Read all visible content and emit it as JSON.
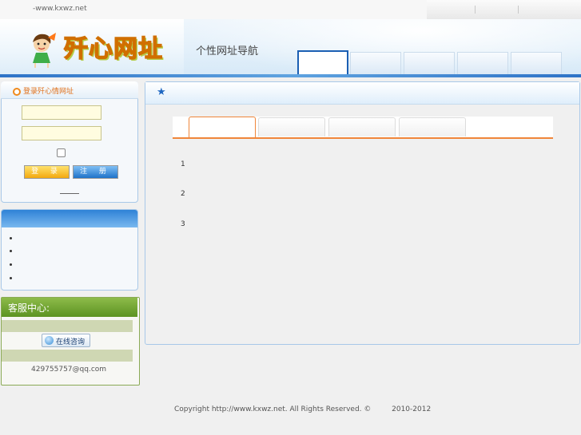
{
  "topbar": {
    "url_text": "-www.kxwz.net"
  },
  "header": {
    "logo_text": "歼心网址",
    "slogan": "个性网址导航",
    "brand_colors": {
      "primary": "#1b5fb3",
      "accent": "#f0863a",
      "logo_yellow": "#ffd21f"
    },
    "nav_tabs": [
      {
        "label": ""
      },
      {
        "label": ""
      },
      {
        "label": ""
      },
      {
        "label": ""
      },
      {
        "label": ""
      }
    ]
  },
  "login": {
    "title": "登录歼心情网址",
    "username_value": "",
    "password_value": "",
    "remember_checked": false,
    "signin_label": "登 录",
    "register_label": "注 册",
    "divider_text": "——"
  },
  "links": {
    "title": "",
    "items": [
      "",
      "",
      "",
      ""
    ]
  },
  "service": {
    "title": "客服中心:",
    "consult_label": "在线咨询",
    "consult_icon": "chat-icon",
    "email": "429755757@qq.com"
  },
  "main": {
    "header_icon": "star-icon",
    "tabs": [
      {
        "label": ""
      },
      {
        "label": ""
      },
      {
        "label": ""
      },
      {
        "label": ""
      }
    ],
    "active_tab": 0,
    "numbers": [
      "1",
      "2",
      "3"
    ]
  },
  "footer": {
    "text": "Copyright http://www.kxwz.net. All Rights Reserved. ©         2010-2012"
  }
}
